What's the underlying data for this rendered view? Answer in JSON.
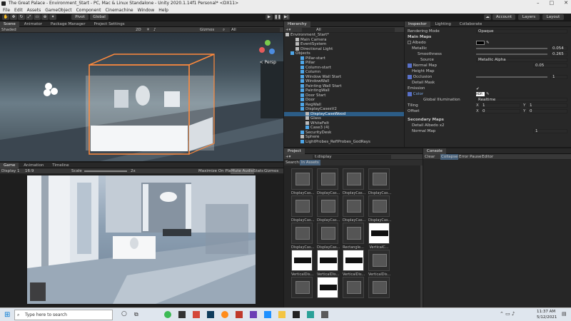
{
  "title": "The Great Palace - Environment_Start - PC, Mac & Linux Standalone - Unity 2020.1.14f1 Personal* <DX11>",
  "menu": [
    "File",
    "Edit",
    "Assets",
    "GameObject",
    "Component",
    "Cinemachine",
    "Window",
    "Help"
  ],
  "toolbar": {
    "pivot": "Pivot",
    "global": "Global",
    "account": "Account",
    "layers": "Layers",
    "layout": "Layout"
  },
  "scene_panel": {
    "tabs": [
      "Scene",
      "Animator",
      "Package Manager",
      "Project Settings"
    ],
    "shading": "Shaded",
    "mode2d": "2D",
    "gizmos": "Gizmos",
    "all": "All",
    "persp": "< Persp"
  },
  "game_panel": {
    "tabs": [
      "Game",
      "Animation",
      "Timeline"
    ],
    "display": "Display 1",
    "aspect": "16:9",
    "scale_label": "Scale",
    "scale_value": "2x",
    "max": "Maximize On Play",
    "mute": "Mute Audio",
    "stats": "Stats",
    "gizmos": "Gizmos"
  },
  "hierarchy": {
    "tab": "Hierarchy",
    "search_placeholder": "All",
    "rows": [
      {
        "label": "Environment_Start*",
        "indent": 0,
        "icon": "unity"
      },
      {
        "label": "Main Camera",
        "indent": 2,
        "icon": "cube"
      },
      {
        "label": "EventSystem",
        "indent": 2,
        "icon": "cube"
      },
      {
        "label": "Directional Light",
        "indent": 2,
        "icon": "cube"
      },
      {
        "label": "Objects",
        "indent": 1,
        "icon": "prefab"
      },
      {
        "label": "Pillar-start",
        "indent": 3,
        "icon": "prefab"
      },
      {
        "label": "Pillar",
        "indent": 3,
        "icon": "prefab"
      },
      {
        "label": "Column-start",
        "indent": 3,
        "icon": "prefab"
      },
      {
        "label": "Column",
        "indent": 3,
        "icon": "prefab"
      },
      {
        "label": "Window Wall Start",
        "indent": 3,
        "icon": "prefab"
      },
      {
        "label": "WindowWall",
        "indent": 3,
        "icon": "prefab"
      },
      {
        "label": "Painting Wall Start",
        "indent": 3,
        "icon": "prefab"
      },
      {
        "label": "PaintingWall",
        "indent": 3,
        "icon": "prefab"
      },
      {
        "label": "Door Start",
        "indent": 3,
        "icon": "prefab"
      },
      {
        "label": "Door",
        "indent": 3,
        "icon": "prefab"
      },
      {
        "label": "RegWall",
        "indent": 3,
        "icon": "prefab"
      },
      {
        "label": "DisplayCasesV2",
        "indent": 3,
        "icon": "prefab"
      },
      {
        "label": "DisplayCaseWood",
        "indent": 4,
        "icon": "cube",
        "selected": true
      },
      {
        "label": "Glass",
        "indent": 4,
        "icon": "cube"
      },
      {
        "label": "WhiteFelt",
        "indent": 4,
        "icon": "cube"
      },
      {
        "label": "Case3 (4)",
        "indent": 4,
        "icon": "prefab"
      },
      {
        "label": "SecurityDesk",
        "indent": 3,
        "icon": "prefab"
      },
      {
        "label": "Sphere",
        "indent": 3,
        "icon": "cube"
      },
      {
        "label": "LightProbes_ReflProbes_GodRays",
        "indent": 3,
        "icon": "prefab"
      }
    ]
  },
  "inspector": {
    "tabs": [
      "Inspector",
      "Lighting",
      "Collaborate"
    ],
    "rendering_mode_label": "Rendering Mode",
    "rendering_mode_value": "Opaque",
    "main_maps": "Main Maps",
    "albedo": "Albedo",
    "metallic": "Metallic",
    "metallic_value": "0.054",
    "smoothness": "Smoothness",
    "smoothness_value": "0.265",
    "source": "Source",
    "source_value": "Metallic Alpha",
    "normal_map": "Normal Map",
    "normal_value": "0.05",
    "height_map": "Height Map",
    "occlusion": "Occlusion",
    "occlusion_value": "1",
    "detail_mask": "Detail Mask",
    "emission": "Emission",
    "color": "Color",
    "hdr": "HDR",
    "gi": "Global Illumination",
    "gi_value": "Realtime",
    "tiling": "Tiling",
    "tiling_x": "1",
    "tiling_y": "1",
    "offset": "Offset",
    "offset_x": "0",
    "offset_y": "0",
    "secondary_maps": "Secondary Maps",
    "detail_albedo": "Detail Albedo x2",
    "normal_map2": "Normal Map",
    "normal2_value": "1",
    "x": "X",
    "y": "Y"
  },
  "project": {
    "tab": "Project",
    "search_value": "t:display",
    "search_label": "Search:",
    "in_assets": "In Assets",
    "assets": [
      "DisplayCas...",
      "DisplayCas...",
      "DisplayCas...",
      "DisplayCas...",
      "DisplayCas...",
      "DisplayCas...",
      "DisplayCas...",
      "DisplayCas...",
      "DisplayCas...",
      "DisplayCas...",
      "Rectangle...",
      "VerticalC...",
      "VerticalDis...",
      "VerticalDis...",
      "VerticalDis...",
      "VerticalDis...",
      "",
      "",
      "",
      ""
    ]
  },
  "console": {
    "tab": "Console",
    "clear": "Clear",
    "collapse": "Collapse",
    "error_pause": "Error Pause",
    "editor": "Editor"
  },
  "taskbar": {
    "search_placeholder": "Type here to search",
    "time": "11:37 AM",
    "date": "5/12/2021"
  }
}
